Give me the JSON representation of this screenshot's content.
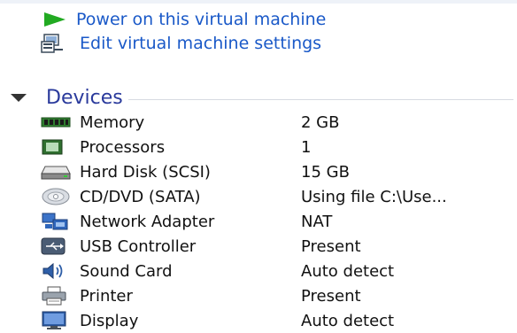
{
  "actions": {
    "power_on_label": "Power on this virtual machine",
    "edit_settings_label": "Edit virtual machine settings"
  },
  "devices": {
    "title": "Devices",
    "items": [
      {
        "name": "Memory",
        "value": "2 GB",
        "icon": "memory-icon"
      },
      {
        "name": "Processors",
        "value": "1",
        "icon": "processor-icon"
      },
      {
        "name": "Hard Disk (SCSI)",
        "value": "15 GB",
        "icon": "hard-disk-icon"
      },
      {
        "name": "CD/DVD (SATA)",
        "value": "Using file C:\\Use...",
        "icon": "cd-dvd-icon"
      },
      {
        "name": "Network Adapter",
        "value": "NAT",
        "icon": "network-adapter-icon"
      },
      {
        "name": "USB Controller",
        "value": "Present",
        "icon": "usb-controller-icon"
      },
      {
        "name": "Sound Card",
        "value": "Auto detect",
        "icon": "sound-card-icon"
      },
      {
        "name": "Printer",
        "value": "Present",
        "icon": "printer-icon"
      },
      {
        "name": "Display",
        "value": "Auto detect",
        "icon": "display-icon"
      }
    ]
  },
  "colors": {
    "link": "#1a59c8",
    "section_title": "#2a3a9c",
    "power_icon": "#22aa22"
  }
}
